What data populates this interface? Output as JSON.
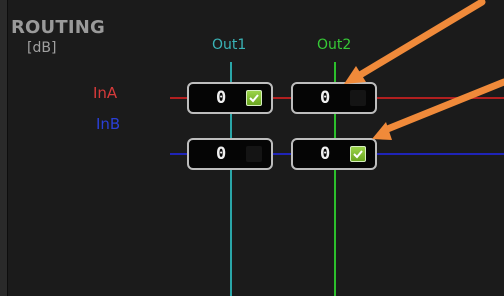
{
  "routing": {
    "title": "ROUTING",
    "unit": "[dB]",
    "columns": [
      "Out1",
      "Out2"
    ],
    "rows": [
      "InA",
      "InB"
    ],
    "values": [
      [
        "0",
        "0"
      ],
      [
        "0",
        "0"
      ]
    ],
    "checked": [
      [
        true,
        false
      ],
      [
        false,
        true
      ]
    ]
  },
  "colors": {
    "out1": "#39b3b6",
    "out2": "#36c936",
    "ina": "#d63a3a",
    "inb": "#2a3fd6",
    "arrow": "#f08a3a",
    "check_on": "#8bc34a"
  },
  "icons": [
    "checkmark-icon",
    "arrow-annotation"
  ]
}
